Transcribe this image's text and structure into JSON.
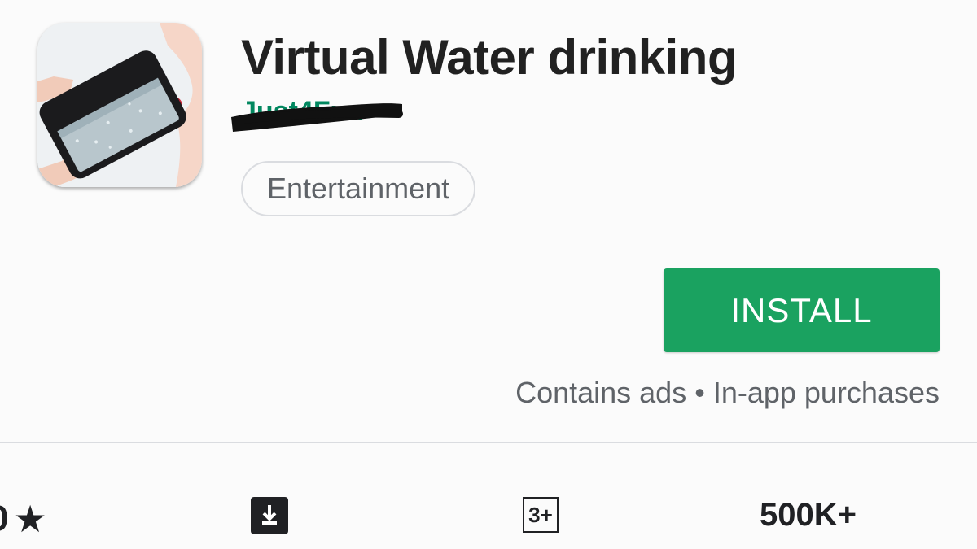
{
  "app": {
    "title": "Virtual Water drinking",
    "developer": "Just4Fun",
    "category": "Entertainment",
    "icon": "water-drinking-phone-icon"
  },
  "actions": {
    "install_label": "INSTALL",
    "ads_note": "Contains ads • In-app purchases"
  },
  "stats": {
    "rating_text": "0",
    "star_glyph": "★",
    "download_icon": "download-icon",
    "age_rating": "3+",
    "installs": "500K+"
  },
  "colors": {
    "accent": "#1aa260",
    "developer_green": "#01875f",
    "text_secondary": "#5f6368"
  }
}
